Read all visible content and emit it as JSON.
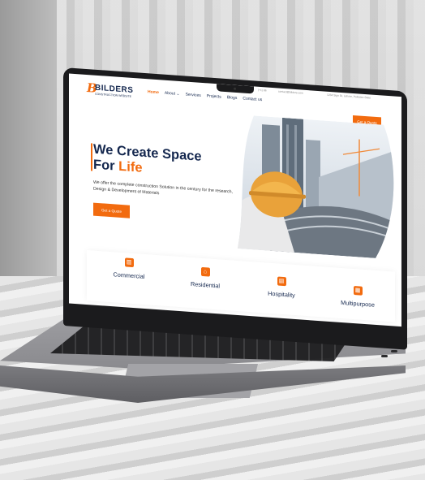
{
  "brand": {
    "logo_letter": "B",
    "name": "BILDERS",
    "tagline": "CONSTRUCTION WEBSITE",
    "accent_color": "#f26b0f",
    "primary_color": "#14274e"
  },
  "nav": {
    "items": [
      "Home",
      "About ⌄",
      "Services",
      "Projects",
      "Blogs",
      "Contact us"
    ],
    "active": "Home"
  },
  "contact": {
    "phone": "(+1) 86",
    "email": "contact@bilders.com",
    "address": "1234 Sign St, Lahore, Pakistan State"
  },
  "header": {
    "quote_button": "Get a Quote"
  },
  "hero": {
    "title_line1": "We Create Space",
    "title_line2_prefix": "For ",
    "title_line2_highlight": "Life",
    "description": "We offer the complete construction Solution in the century for the research, Design & Development of Materials",
    "button": "Get a Quote"
  },
  "services": [
    {
      "label": "Commercial",
      "icon": "bank-icon"
    },
    {
      "label": "Residential",
      "icon": "house-icon"
    },
    {
      "label": "Hospitality",
      "icon": "building-icon"
    },
    {
      "label": "Multipurpose",
      "icon": "buildings-icon"
    }
  ]
}
